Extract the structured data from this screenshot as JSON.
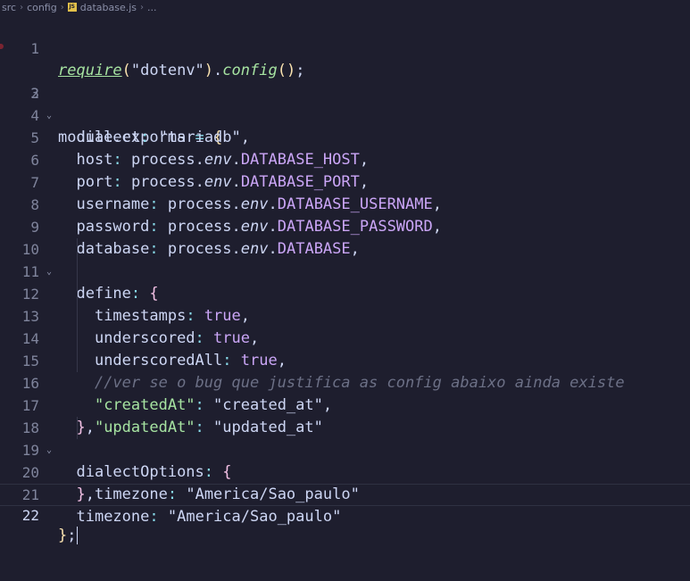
{
  "breadcrumb": {
    "items": [
      "src",
      "config",
      "database.js",
      "..."
    ],
    "file_icon": "JS"
  },
  "editor": {
    "language": "javascript",
    "lines": [
      {
        "n": "1"
      },
      {
        "n": "2"
      },
      {
        "n": "3"
      },
      {
        "n": "4"
      },
      {
        "n": "5"
      },
      {
        "n": "6"
      },
      {
        "n": "7"
      },
      {
        "n": "8"
      },
      {
        "n": "9"
      },
      {
        "n": "10"
      },
      {
        "n": "11"
      },
      {
        "n": "12"
      },
      {
        "n": "13"
      },
      {
        "n": "14"
      },
      {
        "n": "15"
      },
      {
        "n": "16"
      },
      {
        "n": "17"
      },
      {
        "n": "18"
      },
      {
        "n": "19"
      },
      {
        "n": "20"
      },
      {
        "n": "21"
      },
      {
        "n": "22"
      }
    ],
    "tokens": {
      "require": "require",
      "dotenv": "\"dotenv\"",
      "config": "config",
      "module_exports": "module.exports",
      "dialect_key": "dialect",
      "dialect_val": "\"mariadb\"",
      "host_key": "host",
      "port_key": "port",
      "username_key": "username",
      "password_key": "password",
      "database_key": "database",
      "process": "process",
      "env": "env",
      "DATABASE_HOST": "DATABASE_HOST",
      "DATABASE_PORT": "DATABASE_PORT",
      "DATABASE_USERNAME": "DATABASE_USERNAME",
      "DATABASE_PASSWORD": "DATABASE_PASSWORD",
      "DATABASE": "DATABASE",
      "define_key": "define",
      "timestamps_key": "timestamps",
      "underscored_key": "underscored",
      "underscoredAll_key": "underscoredAll",
      "true": "true",
      "comment": "//ver se o bug que justifica as config abaixo ainda existe",
      "createdAt_key": "\"createdAt\"",
      "createdAt_val": "\"created_at\"",
      "updatedAt_key": "\"updatedAt\"",
      "updatedAt_val": "\"updated_at\"",
      "dialectOptions_key": "dialectOptions",
      "timezone_key": "timezone",
      "timezone_val": "\"America/Sao_paulo\""
    }
  },
  "colors": {
    "background": "#1e1e2e",
    "function": "#a6e3a1",
    "keyword": "#cba6f7",
    "brace": "#f5c2e7",
    "paren": "#f9e2af",
    "comment": "#6c7086"
  }
}
